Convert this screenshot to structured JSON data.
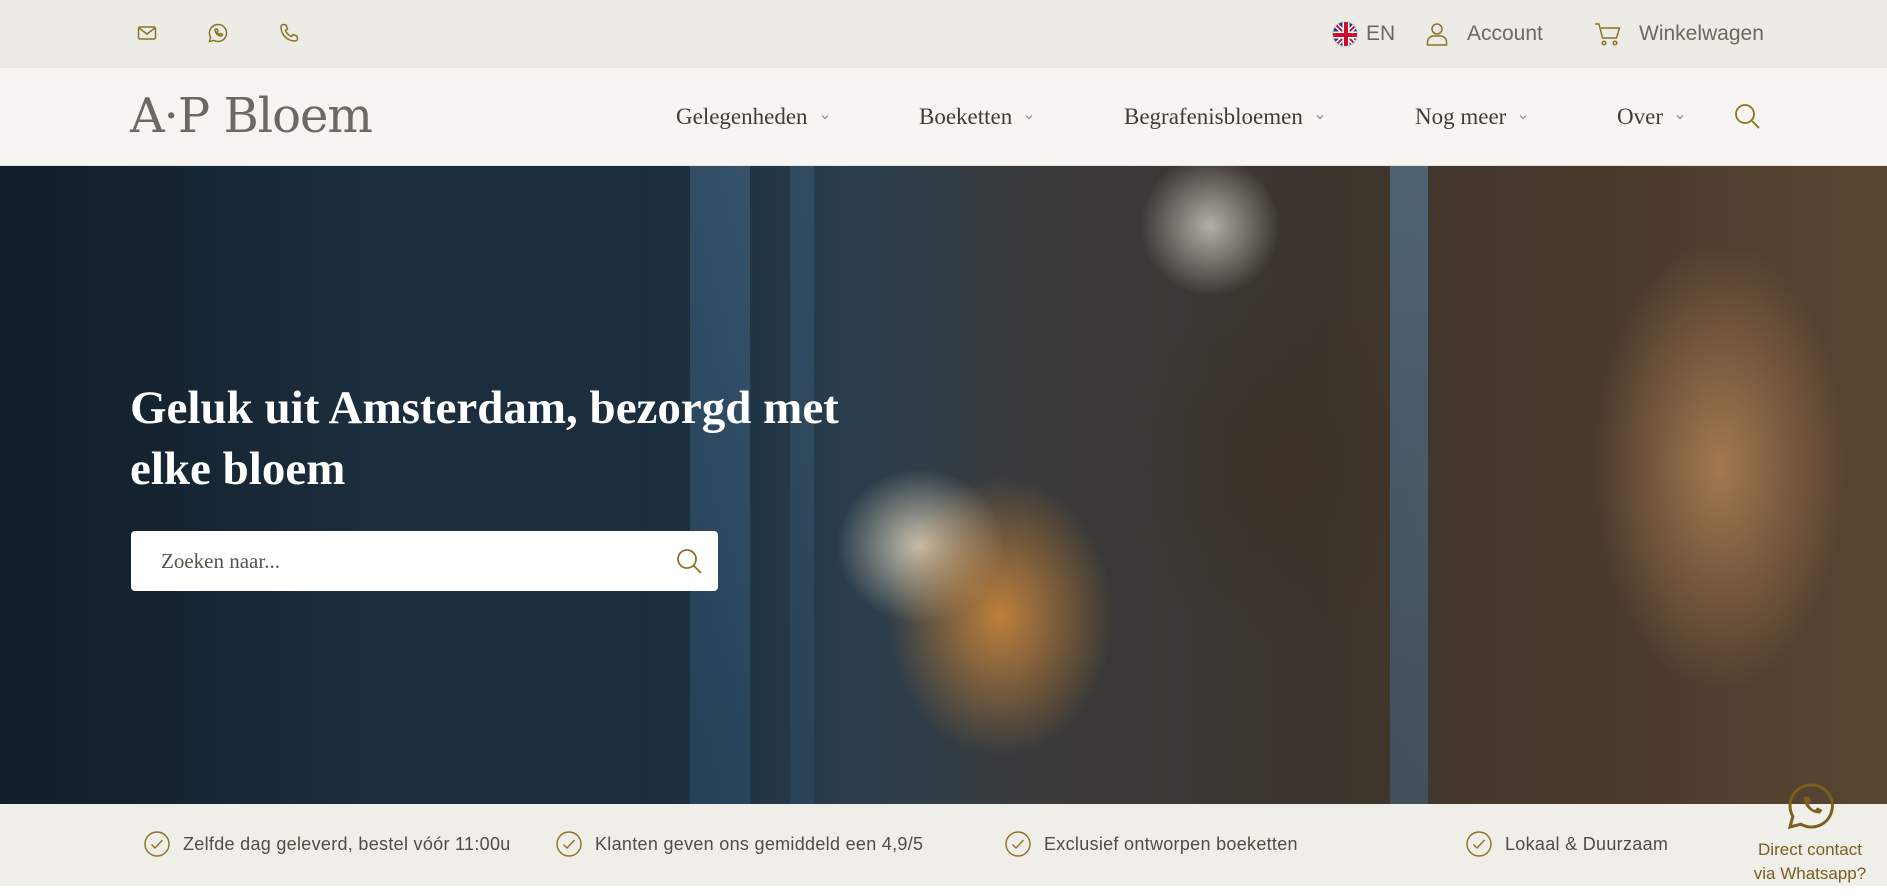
{
  "topbar": {
    "icons": [
      "mail-icon",
      "whatsapp-icon",
      "phone-icon"
    ],
    "language": "EN",
    "account_label": "Account",
    "cart_label": "Winkelwagen"
  },
  "header": {
    "logo_text": "A·P Bloem",
    "nav": [
      {
        "label": "Gelegenheden"
      },
      {
        "label": "Boeketten"
      },
      {
        "label": "Begrafenisbloemen"
      },
      {
        "label": "Nog meer"
      },
      {
        "label": "Over"
      }
    ]
  },
  "hero": {
    "title": "Geluk uit Amsterdam, bezorgd met elke bloem",
    "search_placeholder": "Zoeken naar...",
    "search_value": ""
  },
  "usps": [
    {
      "text": "Zelfde dag geleverd, bestel vóór 11:00u"
    },
    {
      "text": "Klanten geven ons gemiddeld een 4,9/5"
    },
    {
      "text": "Exclusief ontworpen boeketten"
    },
    {
      "text": "Lokaal & Duurzaam"
    }
  ],
  "whatsapp": {
    "line1": "Direct contact",
    "line2": "via Whatsapp?"
  },
  "colors": {
    "accent": "#8a7424",
    "topbar_bg": "#ecebe5",
    "header_bg": "#f6f5f1",
    "text": "#3f3e35"
  }
}
